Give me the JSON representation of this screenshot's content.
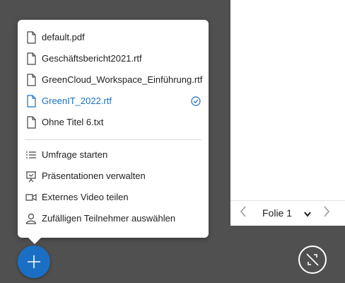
{
  "files": [
    {
      "name": "default.pdf",
      "active": false
    },
    {
      "name": "Geschäftsbericht2021.rtf",
      "active": false
    },
    {
      "name": "GreenCloud_Workspace_Einführung.rtf",
      "active": false
    },
    {
      "name": "GreenIT_2022.rtf",
      "active": true
    },
    {
      "name": "Ohne Titel 6.txt",
      "active": false
    }
  ],
  "actions": [
    {
      "label": "Umfrage starten",
      "icon": "list-icon"
    },
    {
      "label": "Präsentationen verwalten",
      "icon": "presentation-icon"
    },
    {
      "label": "Externes Video teilen",
      "icon": "video-camera-icon"
    },
    {
      "label": "Zufälligen Teilnehmer auswählen",
      "icon": "user-icon"
    }
  ],
  "slide_nav": {
    "current": "Folie 1"
  },
  "colors": {
    "accent": "#1a6fc4",
    "background": "#505050"
  }
}
